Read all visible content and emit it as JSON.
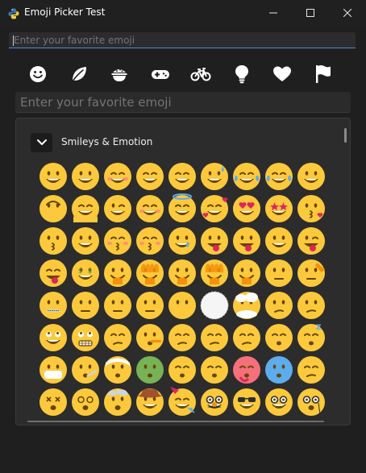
{
  "window": {
    "title": "Emoji Picker Test",
    "title_icon": "python-logo-icon"
  },
  "search_top": {
    "placeholder": "Enter your favorite emoji",
    "value": ""
  },
  "categories": [
    {
      "name": "smileys",
      "icon": "smiley-face-icon"
    },
    {
      "name": "nature",
      "icon": "leaf-icon"
    },
    {
      "name": "food",
      "icon": "food-bowl-icon"
    },
    {
      "name": "activities",
      "icon": "gamepad-icon"
    },
    {
      "name": "travel",
      "icon": "bicycle-icon"
    },
    {
      "name": "objects",
      "icon": "lightbulb-icon"
    },
    {
      "name": "symbols",
      "icon": "heart-icon"
    },
    {
      "name": "flags",
      "icon": "flag-icon"
    }
  ],
  "search_main": {
    "placeholder": "Enter your favorite emoji",
    "value": ""
  },
  "group": {
    "label": "Smileys & Emotion",
    "expanded": true
  },
  "colors": {
    "accent": "#4a90d9",
    "emoji_face": "#fbc93b",
    "background": "#1f1f1f",
    "panel": "#2c2c2c"
  },
  "emoji_rows": [
    [
      "grinning-face",
      "grinning-face-big-eyes",
      "grinning-face-smiling-eyes",
      "beaming-face",
      "grinning-squinting-face",
      "grinning-face-sweat",
      "rolling-on-floor-laughing",
      "face-with-tears-of-joy",
      "slightly-smiling-face"
    ],
    [
      "upside-down-face",
      "melting-face",
      "winking-face",
      "smiling-face-smiling-eyes",
      "smiling-face-halo",
      "smiling-face-hearts",
      "heart-eyes",
      "star-struck",
      "face-blowing-kiss"
    ],
    [
      "kissing-face",
      "smiling-face",
      "kissing-face-closed-eyes",
      "kissing-face-smiling-eyes",
      "smiling-face-tear",
      "face-savoring-food",
      "face-with-tongue",
      "zany-face",
      "winking-face-tongue"
    ],
    [
      "squinting-face-tongue",
      "money-mouth-face",
      "hugging-face",
      "face-open-eyes-hand-over-mouth",
      "face-hand-over-mouth",
      "face-peeking-eye",
      "shushing-face",
      "thinking-face",
      "saluting-face"
    ],
    [
      "zipper-mouth-face",
      "face-raised-eyebrow",
      "neutral-face",
      "expressionless-face",
      "face-without-mouth",
      "dotted-line-face",
      "face-in-clouds",
      "smirking-face",
      "unamused-face"
    ],
    [
      "face-rolling-eyes",
      "grimacing-face",
      "face-exhaling",
      "lying-face",
      "relieved-face",
      "pensive-face",
      "sleepy-face",
      "drooling-face",
      "sleeping-face"
    ],
    [
      "face-medical-mask",
      "face-thermometer",
      "face-head-bandage",
      "nauseated-face",
      "vomiting-face",
      "sneezing-face",
      "hot-face",
      "cold-face",
      "woozy-face"
    ],
    [
      "face-crossed-out-eyes",
      "face-spiral-eyes",
      "exploding-head",
      "cowboy-hat-face",
      "partying-face",
      "disguised-face",
      "smiling-face-sunglasses",
      "nerd-face",
      "face-monocle"
    ]
  ]
}
